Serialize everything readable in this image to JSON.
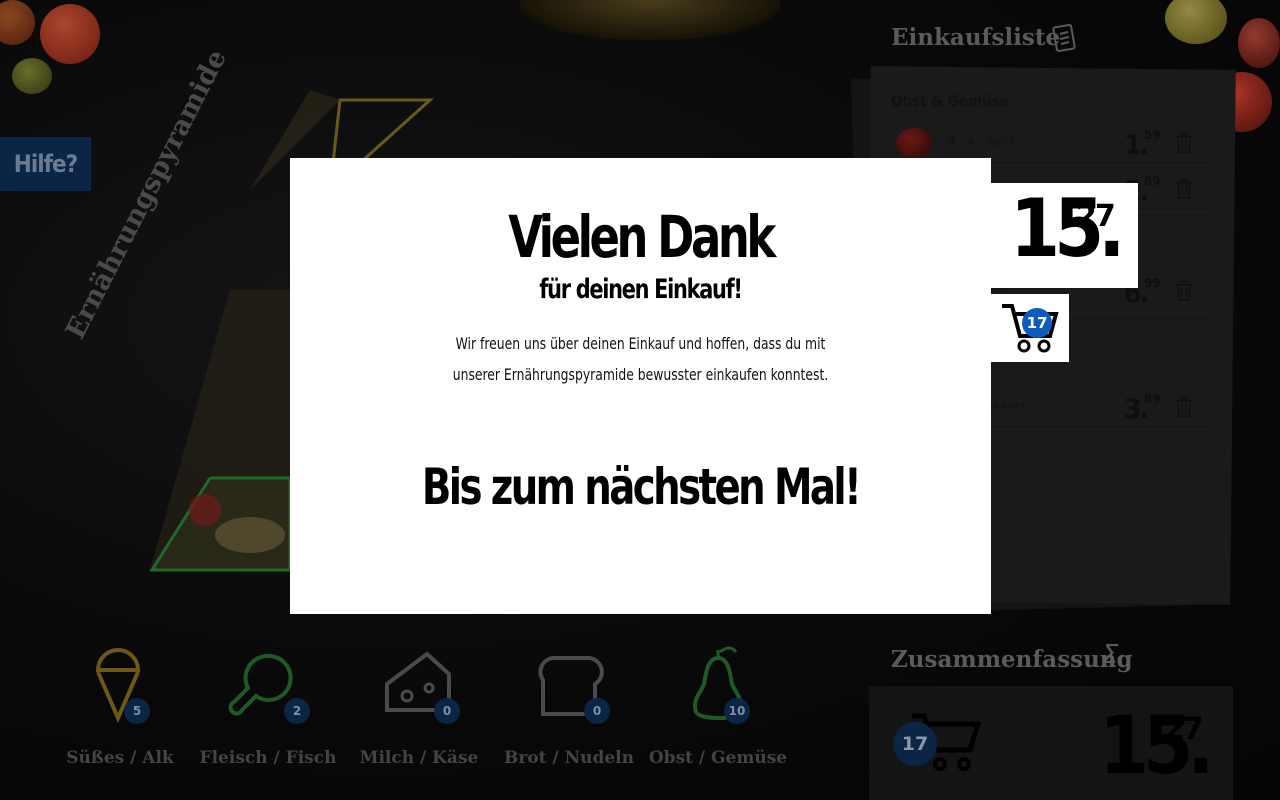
{
  "help": {
    "label": "Hilfe?"
  },
  "pyramid": {
    "title": "Ernährungspyramide"
  },
  "categories": [
    {
      "label": "Süßes / Alk",
      "count": "5",
      "icon": "ice-cream-icon"
    },
    {
      "label": "Fleisch / Fisch",
      "count": "2",
      "icon": "meat-icon"
    },
    {
      "label": "Milch / Käse",
      "count": "0",
      "icon": "cheese-icon"
    },
    {
      "label": "Brot / Nudeln",
      "count": "0",
      "icon": "bread-icon"
    },
    {
      "label": "Obst / Gemüse",
      "count": "10",
      "icon": "pear-icon"
    }
  ],
  "shopping_list": {
    "title": "Einkaufsliste",
    "section": "Obst & Gemüse",
    "items": [
      {
        "qty": "4",
        "x": "x",
        "name": "Apfel",
        "price_main": "1.",
        "price_sup": "59"
      },
      {
        "price_main": "2.",
        "price_sup": "89"
      },
      {
        "name_fragment": "Brot",
        "price_main": "6.",
        "price_sup": "99"
      },
      {
        "name_fragment": "nickers",
        "price_main": "3.",
        "price_sup": "89"
      }
    ],
    "total_main": "15.",
    "total_sup": "27",
    "cart_count": "17"
  },
  "summary": {
    "title": "Zusammenfassung",
    "sigma": "Σ",
    "cart_count": "17",
    "total_main": "15.",
    "total_sup": "27"
  },
  "modal": {
    "title": "Vielen Dank",
    "subtitle": "für deinen Einkauf!",
    "text": "Wir freuen uns über deinen Einkauf und hoffen, dass du mit unserer Ernährungspyramide bewusster einkaufen konntest.",
    "farewell": "Bis zum nächsten Mal!"
  },
  "colors": {
    "accent_blue": "#0d5bbf",
    "help_bg": "#0b2546",
    "pyramid_gold": "#c9a227",
    "pyramid_green": "#3fae49"
  }
}
